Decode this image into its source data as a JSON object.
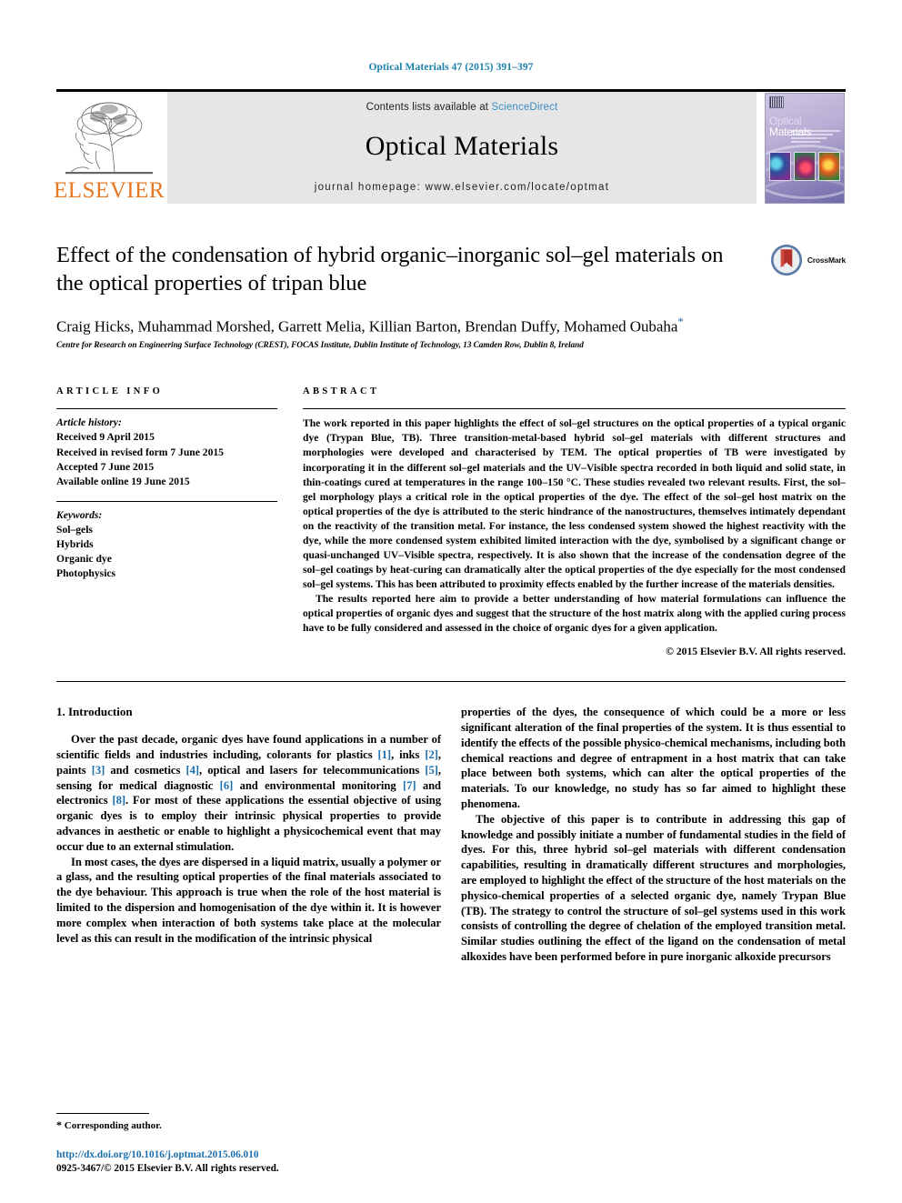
{
  "running_head": "Optical Materials 47 (2015) 391–397",
  "masthead": {
    "publisher_word": "ELSEVIER",
    "contents_prefix": "Contents lists available at ",
    "sciencedirect": "ScienceDirect",
    "journal_title": "Optical Materials",
    "homepage": "journal homepage: www.elsevier.com/locate/optmat",
    "cover_title_1": "Optical ",
    "cover_title_2": "Materials"
  },
  "article": {
    "title": "Effect of the condensation of hybrid organic–inorganic sol–gel materials on the optical properties of tripan blue",
    "crossmark_label": "CrossMark",
    "authors": "Craig Hicks, Muhammad Morshed, Garrett Melia, Killian Barton, Brendan Duffy, Mohamed Oubaha",
    "author_marker": "*",
    "affiliation": "Centre for Research on Engineering Surface Technology (CREST), FOCAS Institute, Dublin Institute of Technology, 13 Camden Row, Dublin 8, Ireland"
  },
  "article_info": {
    "heading": "ARTICLE INFO",
    "history_label": "Article history:",
    "history": [
      "Received 9 April 2015",
      "Received in revised form 7 June 2015",
      "Accepted 7 June 2015",
      "Available online 19 June 2015"
    ],
    "keywords_label": "Keywords:",
    "keywords": [
      "Sol–gels",
      "Hybrids",
      "Organic dye",
      "Photophysics"
    ]
  },
  "abstract": {
    "heading": "ABSTRACT",
    "paragraph_1": "The work reported in this paper highlights the effect of sol–gel structures on the optical properties of a typical organic dye (Trypan Blue, TB). Three transition-metal-based hybrid sol–gel materials with different structures and morphologies were developed and characterised by TEM. The optical properties of TB were investigated by incorporating it in the different sol–gel materials and the UV–Visible spectra recorded in both liquid and solid state, in thin-coatings cured at temperatures in the range 100–150 °C. These studies revealed two relevant results. First, the sol–gel morphology plays a critical role in the optical properties of the dye. The effect of the sol–gel host matrix on the optical properties of the dye is attributed to the steric hindrance of the nanostructures, themselves intimately dependant on the reactivity of the transition metal. For instance, the less condensed system showed the highest reactivity with the dye, while the more condensed system exhibited limited interaction with the dye, symbolised by a significant change or quasi-unchanged UV–Visible spectra, respectively. It is also shown that the increase of the condensation degree of the sol–gel coatings by heat-curing can dramatically alter the optical properties of the dye especially for the most condensed sol–gel systems. This has been attributed to proximity effects enabled by the further increase of the materials densities.",
    "paragraph_2": "The results reported here aim to provide a better understanding of how material formulations can influence the optical properties of organic dyes and suggest that the structure of the host matrix along with the applied curing process have to be fully considered and assessed in the choice of organic dyes for a given application.",
    "copyright": "© 2015 Elsevier B.V. All rights reserved."
  },
  "introduction": {
    "heading": "1. Introduction",
    "left_col": {
      "p1_a": "Over the past decade, organic dyes have found applications in a number of scientific fields and industries including, colorants for plastics ",
      "r1": "[1]",
      "p1_b": ", inks ",
      "r2": "[2]",
      "p1_c": ", paints ",
      "r3": "[3]",
      "p1_d": " and cosmetics ",
      "r4": "[4]",
      "p1_e": ", optical and lasers for telecommunications ",
      "r5": "[5]",
      "p1_f": ", sensing for medical diagnostic ",
      "r6": "[6]",
      "p1_g": " and environmental monitoring ",
      "r7": "[7]",
      "p1_h": " and electronics ",
      "r8": "[8]",
      "p1_i": ". For most of these applications the essential objective of using organic dyes is to employ their intrinsic physical properties to provide advances in aesthetic or enable to highlight a physicochemical event that may occur due to an external stimulation.",
      "p2": "In most cases, the dyes are dispersed in a liquid matrix, usually a polymer or a glass, and the resulting optical properties of the final materials associated to the dye behaviour. This approach is true when the role of the host material is limited to the dispersion and homogenisation of the dye within it. It is however more complex when interaction of both systems take place at the molecular level as this can result in the modification of the intrinsic physical"
    },
    "right_col": {
      "p1": "properties of the dyes, the consequence of which could be a more or less significant alteration of the final properties of the system. It is thus essential to identify the effects of the possible physico-chemical mechanisms, including both chemical reactions and degree of entrapment in a host matrix that can take place between both systems, which can alter the optical properties of the materials. To our knowledge, no study has so far aimed to highlight these phenomena.",
      "p2": "The objective of this paper is to contribute in addressing this gap of knowledge and possibly initiate a number of fundamental studies in the field of dyes. For this, three hybrid sol–gel materials with different condensation capabilities, resulting in dramatically different structures and morphologies, are employed to highlight the effect of the structure of the host materials on the physico-chemical properties of a selected organic dye, namely Trypan Blue (TB). The strategy to control the structure of sol–gel systems used in this work consists of controlling the degree of chelation of the employed transition metal. Similar studies outlining the effect of the ligand on the condensation of metal alkoxides have been performed before in pure inorganic alkoxide precursors"
    }
  },
  "footer": {
    "corresponding_marker": "*",
    "corresponding_author": "Corresponding author.",
    "doi": "http://dx.doi.org/10.1016/j.optmat.2015.06.010",
    "issn_line": "0925-3467/© 2015 Elsevier B.V. All rights reserved."
  },
  "colors": {
    "link_blue": "#1a6fae",
    "header_blue": "#1a7fa8",
    "sciencedirect_blue": "#3c8ec4",
    "elsevier_orange": "#E87722"
  }
}
